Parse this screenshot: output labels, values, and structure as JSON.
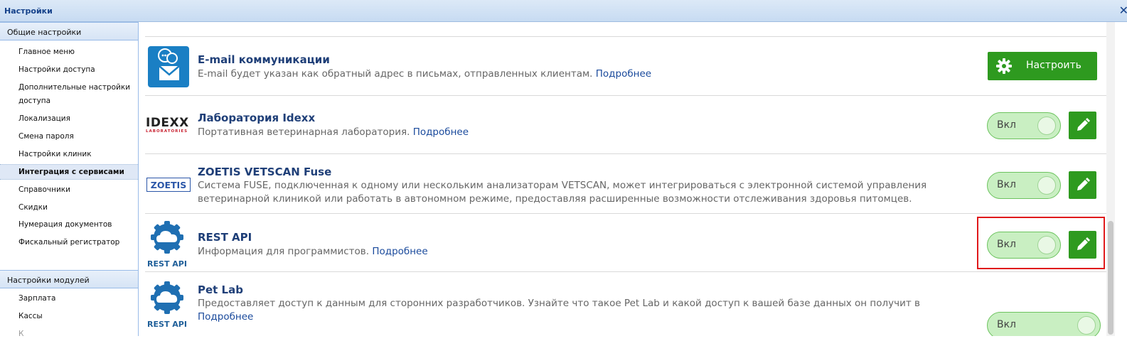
{
  "window": {
    "title": "Настройки",
    "close": "✕"
  },
  "sidebar": {
    "group1": "Общие настройки",
    "items1": [
      "Главное меню",
      "Настройки доступа",
      "Дополнительные настройки",
      "доступа",
      "Локализация",
      "Смена пароля",
      "Настройки клиник",
      "Интеграция с сервисами",
      "Справочники",
      "Скидки",
      "Нумерация документов",
      "Фискальный регистратор"
    ],
    "group2": "Настройки модулей",
    "items2": [
      "Зарплата",
      "Кассы"
    ]
  },
  "integrations": [
    {
      "name": "E-mail коммуникации",
      "desc": "E-mail будет указан как обратный адрес в письмах, отправленных клиентам.",
      "more": "Подробнее",
      "action": "Настроить",
      "icon": "email-chat-icon"
    },
    {
      "name": "Лаборатория Idexx",
      "desc": "Портативная ветеринарная лаборатория.",
      "more": "Подробнее",
      "toggle": "Вкл",
      "logo_text": "IDEXX",
      "logo_sub": "LABORATORIES"
    },
    {
      "name": "ZOETIS VETSCAN Fuse",
      "desc": "Система FUSE, подключенная к одному или нескольким анализаторам VETSCAN, может интегрироваться с электронной системой управления ветеринарной клиникой или работать в автономном режиме, предоставляя расширенные возможности отслеживания здоровья питомцев.",
      "more": "",
      "toggle": "Вкл",
      "logo_text": "ZOETIS"
    },
    {
      "name": "REST API",
      "desc": "Информация для программистов.",
      "more": "Подробнее",
      "toggle": "Вкл",
      "logo_caption": "REST API"
    },
    {
      "name": "Pet Lab",
      "desc": "Предоставляет доступ к данным для сторонних разработчиков. Узнайте что такое Pet Lab и какой доступ к вашей базе данных он получит в",
      "more": "Подробнее",
      "toggle": "Вкл",
      "logo_caption": "REST API"
    }
  ],
  "colors": {
    "accent_green": "#2e9a1f",
    "toggle_bg": "#c9efc2",
    "link": "#1a4a9c",
    "highlight": "#e0191b"
  }
}
